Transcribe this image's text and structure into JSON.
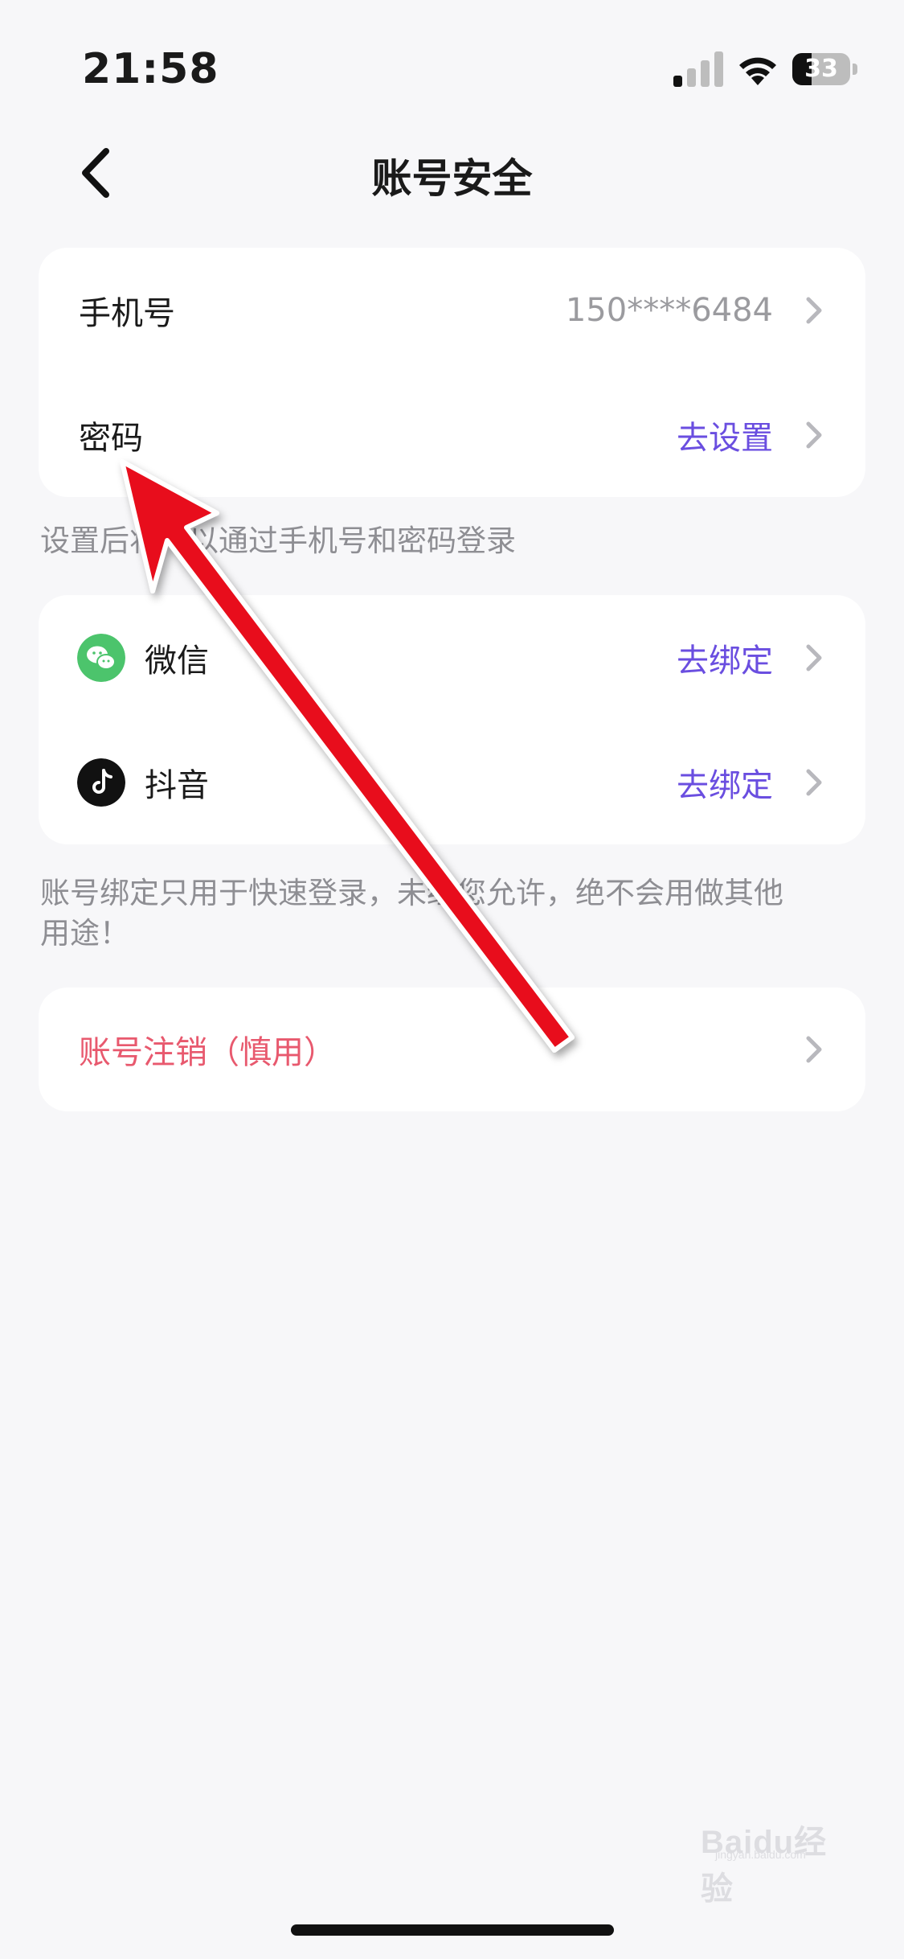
{
  "status_bar": {
    "time": "21:58",
    "battery": "33",
    "battery_level": 0.33
  },
  "nav": {
    "title": "账号安全",
    "back_icon": "chevron-left-icon"
  },
  "login_card": {
    "phone": {
      "label": "手机号",
      "value": "150****6484"
    },
    "password": {
      "label": "密码",
      "value": "去设置"
    }
  },
  "login_note": "设置后将可以通过手机号和密码登录",
  "binding_card": {
    "wechat": {
      "label": "微信",
      "value": "去绑定",
      "icon": "wechat-icon",
      "icon_color": "#4cc46c"
    },
    "douyin": {
      "label": "抖音",
      "value": "去绑定",
      "icon": "douyin-icon",
      "icon_color": "#111111"
    }
  },
  "binding_note": "账号绑定只用于快速登录，未经您允许，绝不会用做其他用途！",
  "danger_card": {
    "deactivate": {
      "label": "账号注销（慎用）"
    }
  },
  "watermark": {
    "text": "Baidu经验",
    "sub": "jingyan.baidu.com"
  },
  "colors": {
    "accent": "#6a4ee0",
    "danger": "#e8596e",
    "annotation_arrow": "#e8101a"
  }
}
